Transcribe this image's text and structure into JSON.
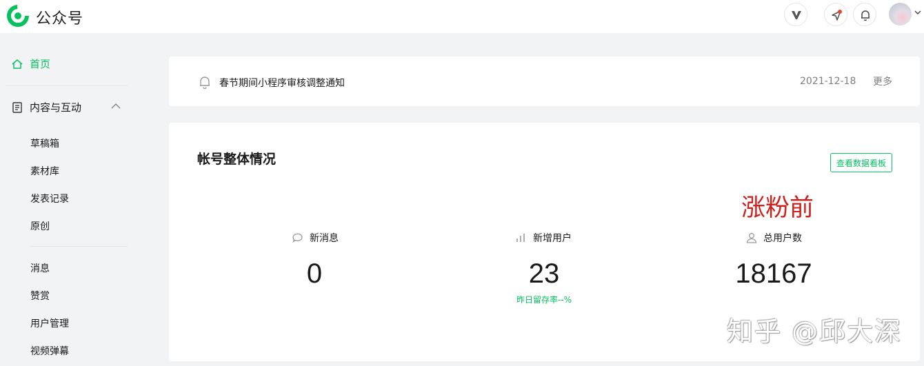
{
  "brand": {
    "name": "公众号",
    "accent_color": "#07c160"
  },
  "topbar": {
    "icons": [
      "y-brand-icon",
      "send-icon",
      "bell-icon"
    ],
    "avatar": "avatar"
  },
  "sidebar": {
    "home_label": "首页",
    "section_label": "内容与互动",
    "section_items": [
      "草稿箱",
      "素材库",
      "发表记录",
      "原创"
    ],
    "other_items": [
      "消息",
      "赞赏",
      "用户管理",
      "视频弹幕"
    ]
  },
  "notice": {
    "title": "春节期间小程序审核调整通知",
    "date": "2021-12-18",
    "more_label": "更多"
  },
  "overview": {
    "title": "帐号整体情况",
    "button_label": "查看数据看板",
    "annotation": "涨粉前",
    "stats": [
      {
        "label": "新消息",
        "value": "0",
        "icon": "chat-bubble-icon"
      },
      {
        "label": "新增用户",
        "value": "23",
        "sub": "昨日留存率--%",
        "icon": "bar-chart-icon"
      },
      {
        "label": "总用户数",
        "value": "18167",
        "icon": "user-icon"
      }
    ]
  },
  "watermark": "知乎 @邱大深"
}
